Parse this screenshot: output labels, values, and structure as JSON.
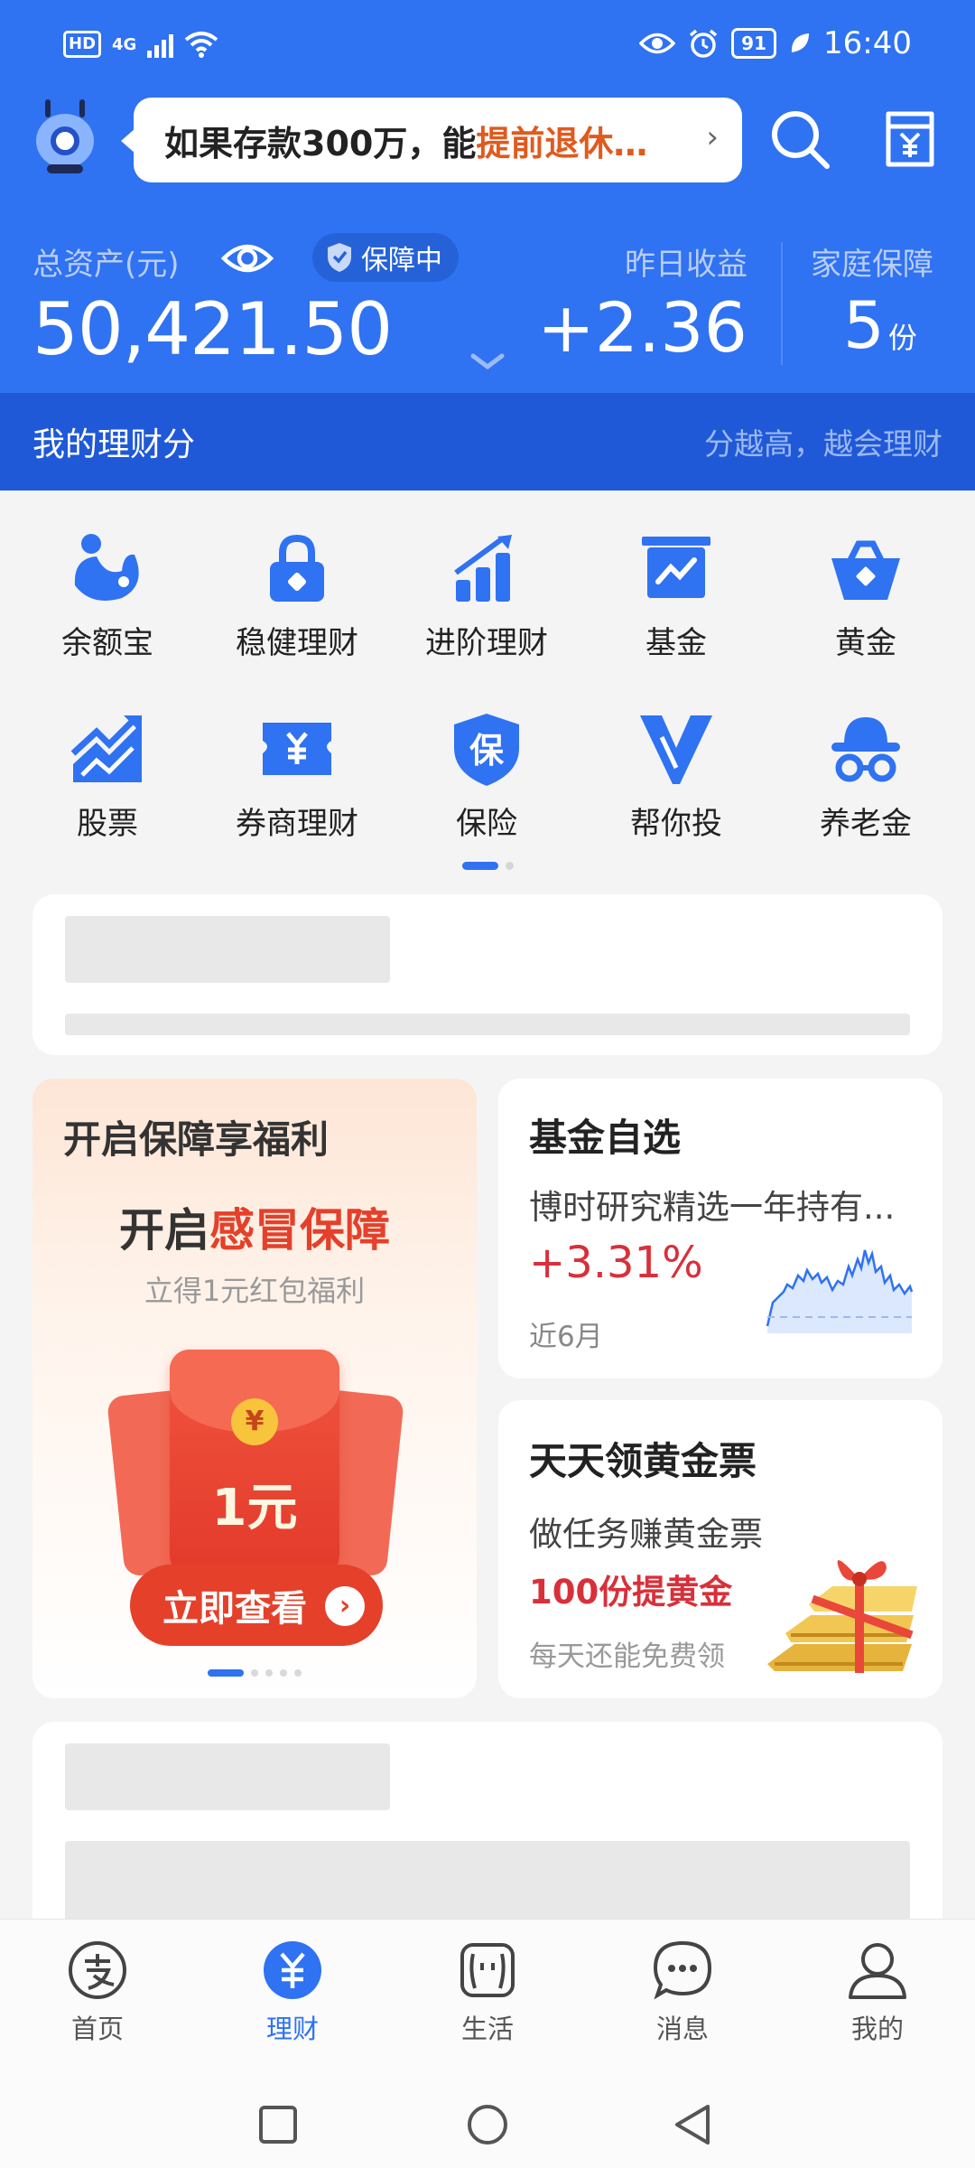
{
  "status_bar": {
    "network": "4G",
    "hd": "HD",
    "battery": "91",
    "time": "16:40"
  },
  "header": {
    "ticker_text": "如果存款300万，能",
    "ticker_highlight": "提前退休…",
    "total_assets_label": "总资产(元)",
    "protection_badge": "保障中",
    "total_assets_value": "50,421.50",
    "yesterday_label": "昨日收益",
    "yesterday_value": "+2.36",
    "family_label": "家庭保障",
    "family_value": "5",
    "family_unit": "份",
    "score_title": "我的理财分",
    "score_subtitle": "分越高，越会理财"
  },
  "grid": [
    {
      "label": "余额宝",
      "icon": "yuebao-icon"
    },
    {
      "label": "稳健理财",
      "icon": "lock-icon"
    },
    {
      "label": "进阶理财",
      "icon": "bar-chart-icon"
    },
    {
      "label": "基金",
      "icon": "fund-chart-icon"
    },
    {
      "label": "黄金",
      "icon": "gold-basket-icon"
    },
    {
      "label": "股票",
      "icon": "stock-trend-icon"
    },
    {
      "label": "券商理财",
      "icon": "broker-ticket-icon"
    },
    {
      "label": "保险",
      "icon": "insurance-shield-icon"
    },
    {
      "label": "帮你投",
      "icon": "invest-v-icon"
    },
    {
      "label": "养老金",
      "icon": "pension-hat-icon"
    }
  ],
  "promo": {
    "title": "开启保障享福利",
    "headline_prefix": "开启",
    "headline_highlight": "感冒保障",
    "subtitle": "立得1元红包福利",
    "coin_symbol": "¥",
    "amount": "1元",
    "button": "立即查看"
  },
  "fund_card": {
    "title": "基金自选",
    "fund_name": "博时研究精选一年持有...",
    "rate": "+3.31%",
    "period": "近6月"
  },
  "gold_card": {
    "title": "天天领黄金票",
    "line1": "做任务赚黄金票",
    "line2": "100份提黄金",
    "line3": "每天还能免费领"
  },
  "tabbar": [
    {
      "label": "首页",
      "active": false
    },
    {
      "label": "理财",
      "active": true
    },
    {
      "label": "生活",
      "active": false
    },
    {
      "label": "消息",
      "active": false
    },
    {
      "label": "我的",
      "active": false
    }
  ],
  "colors": {
    "brand_blue": "#2f72f2",
    "gain_red": "#d8303a",
    "accent_orange": "#e05a1e"
  }
}
